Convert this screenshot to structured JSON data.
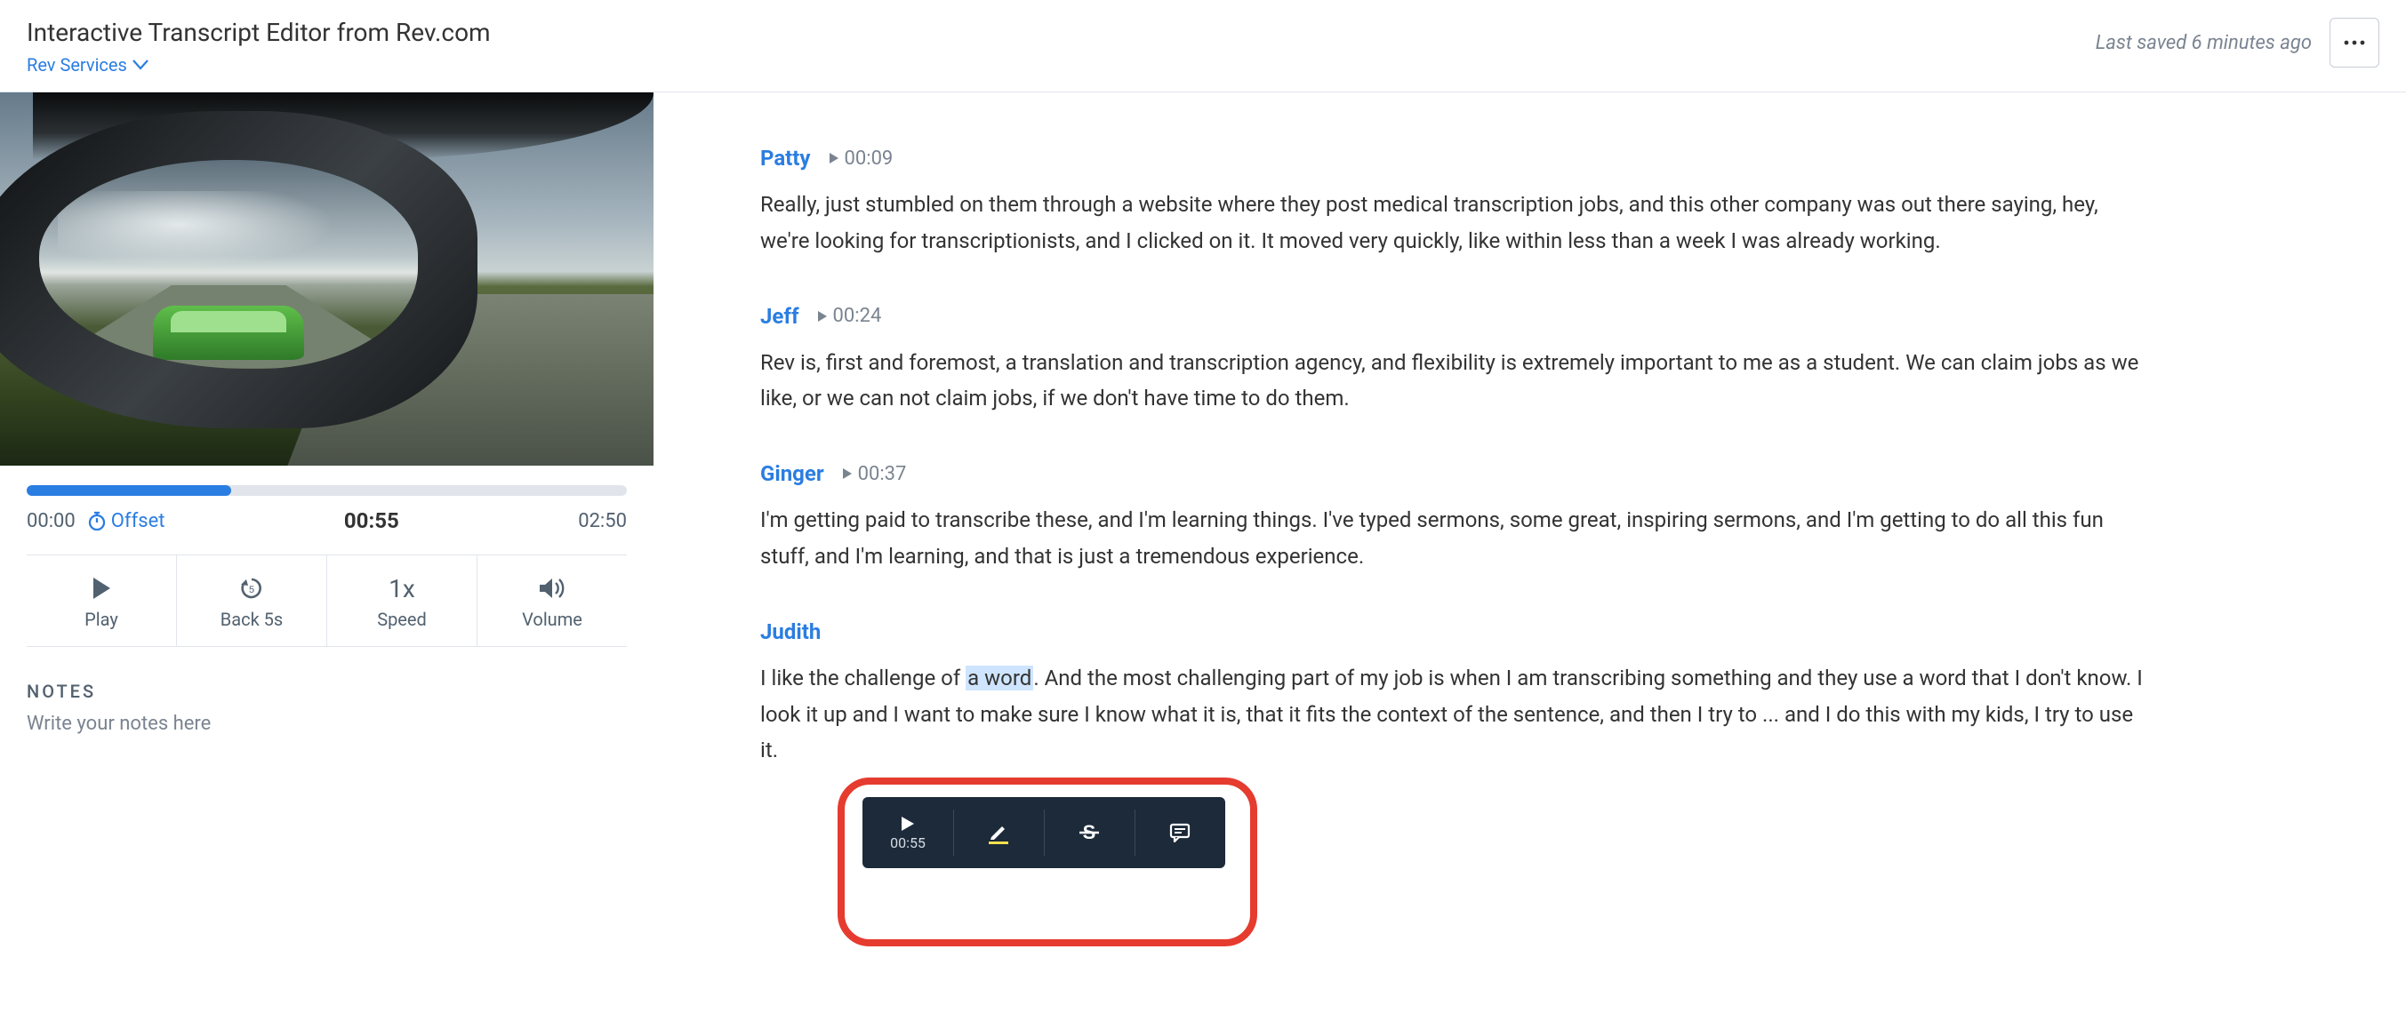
{
  "header": {
    "title": "Interactive Transcript Editor from Rev.com",
    "breadcrumb": "Rev Services",
    "save_status": "Last saved 6 minutes ago",
    "more_label": "…"
  },
  "player": {
    "progress_percent": 34,
    "time_start": "00:00",
    "offset_label": "Offset",
    "time_current": "00:55",
    "time_end": "02:50",
    "buttons": {
      "play": "Play",
      "back": "Back 5s",
      "speed_value": "1x",
      "speed_label": "Speed",
      "volume": "Volume"
    }
  },
  "notes": {
    "label": "NOTES",
    "placeholder": "Write your notes here"
  },
  "transcript": [
    {
      "speaker": "Patty",
      "time": "00:09",
      "text": "Really, just stumbled on them through a website where they post medical transcription jobs, and this other company was out there saying, hey, we're looking for transcriptionists, and I clicked on it. It moved very quickly, like within less than a week I was already working."
    },
    {
      "speaker": "Jeff",
      "time": "00:24",
      "text": "Rev is, first and foremost, a translation and transcription agency, and flexibility is extremely important to me as a student. We can claim jobs as we like, or we can not claim jobs, if we don't have time to do them."
    },
    {
      "speaker": "Ginger",
      "time": "00:37",
      "text": "I'm getting paid to transcribe these, and I'm learning things. I've typed sermons, some great, inspiring sermons, and I'm getting to do all this fun stuff, and I'm learning, and that is just a tremendous experience."
    },
    {
      "speaker": "Judith",
      "time": "",
      "pre": "I like the challenge of ",
      "hl": "a word",
      "post": ". And the most challenging part of my job is when I am transcribing something and they use a word that I don't know. I look it up and I want to make sure I know what it is, that it fits the context of the sentence, and then I try to ... and I do this with my kids, I try to use it."
    }
  ],
  "toolbar": {
    "play_time": "00:55",
    "icons": {
      "play": "play-icon",
      "highlight": "highlight-icon",
      "strike": "strikethrough-icon",
      "comment": "comment-icon"
    }
  }
}
